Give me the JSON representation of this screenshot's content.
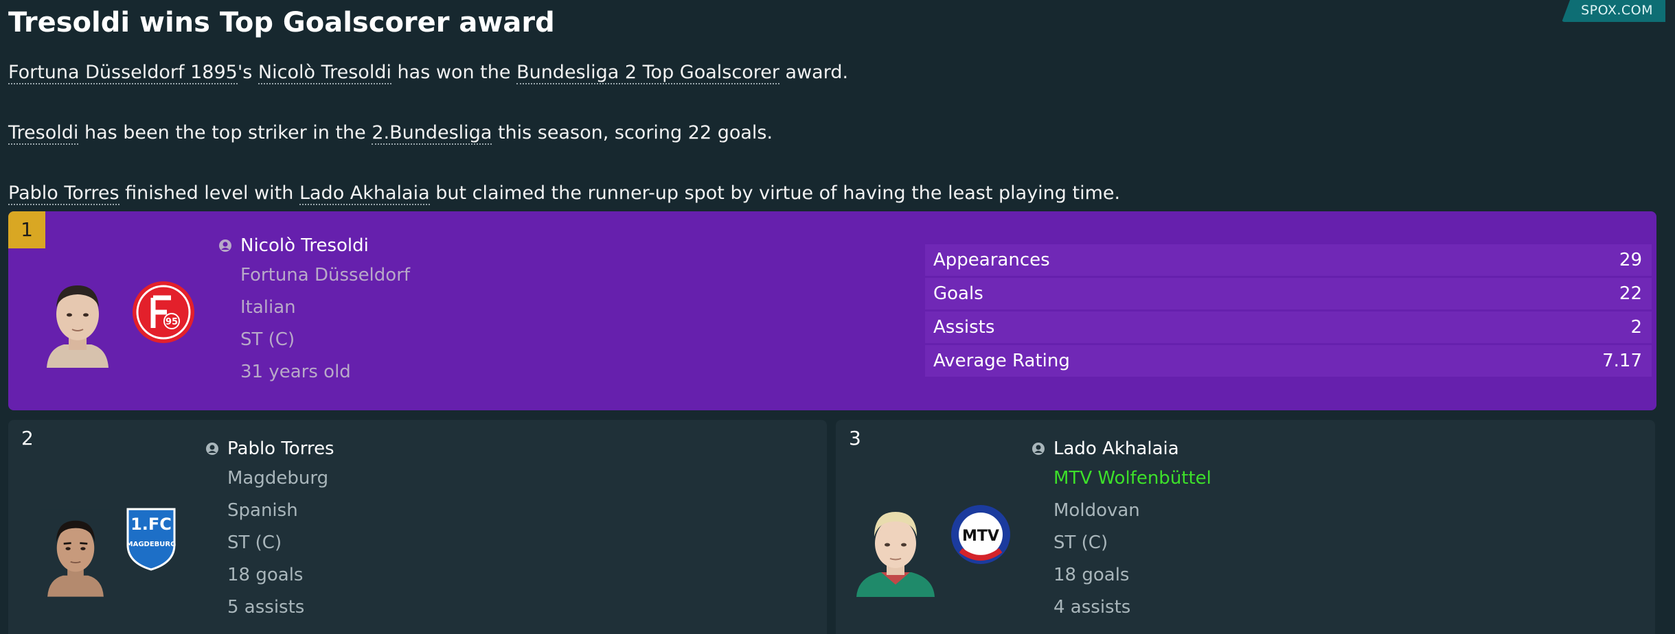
{
  "source": "SPOX.COM",
  "headline": "Tresoldi wins Top Goalscorer award",
  "paragraphs": {
    "p1": {
      "club": "Fortuna Düsseldorf 1895",
      "mid1": "'s ",
      "player": "Nicolò Tresoldi",
      "mid2": " has won the ",
      "award": "Bundesliga 2 Top Goalscorer",
      "end": " award."
    },
    "p2": {
      "player": "Tresoldi",
      "mid1": " has been the top striker in the ",
      "league": "2.Bundesliga",
      "end": " this season, scoring 22 goals."
    },
    "p3": {
      "player1": "Pablo Torres",
      "mid1": " finished level with ",
      "player2": "Lado Akhalaia",
      "end": " but claimed the runner-up spot by virtue of having the least playing time."
    }
  },
  "winner": {
    "rank": "1",
    "name": "Nicolò Tresoldi",
    "club": "Fortuna Düsseldorf",
    "nationality": "Italian",
    "position": "ST (C)",
    "age": "31 years old",
    "crest_text": "95",
    "stats": [
      {
        "label": "Appearances",
        "value": "29"
      },
      {
        "label": "Goals",
        "value": "22"
      },
      {
        "label": "Assists",
        "value": "2"
      },
      {
        "label": "Average Rating",
        "value": "7.17"
      }
    ]
  },
  "second": {
    "rank": "2",
    "name": "Pablo Torres",
    "club": "Magdeburg",
    "nationality": "Spanish",
    "position": "ST (C)",
    "goals": "18 goals",
    "assists": "5 assists",
    "crest_text_top": "1.FC",
    "crest_text_bottom": "MAGDEBURG"
  },
  "third": {
    "rank": "3",
    "name": "Lado Akhalaia",
    "club": "MTV Wolfenbüttel",
    "nationality": "Moldovan",
    "position": "ST (C)",
    "goals": "18 goals",
    "assists": "4 assists",
    "crest_text": "MTV"
  },
  "colors": {
    "background": "#17282f",
    "winner_card": "#6620ad",
    "rank_badge": "#d9a723",
    "runner_card": "#1f3038",
    "club_link_green": "#3de02a",
    "source_tab": "#0e6e74"
  }
}
